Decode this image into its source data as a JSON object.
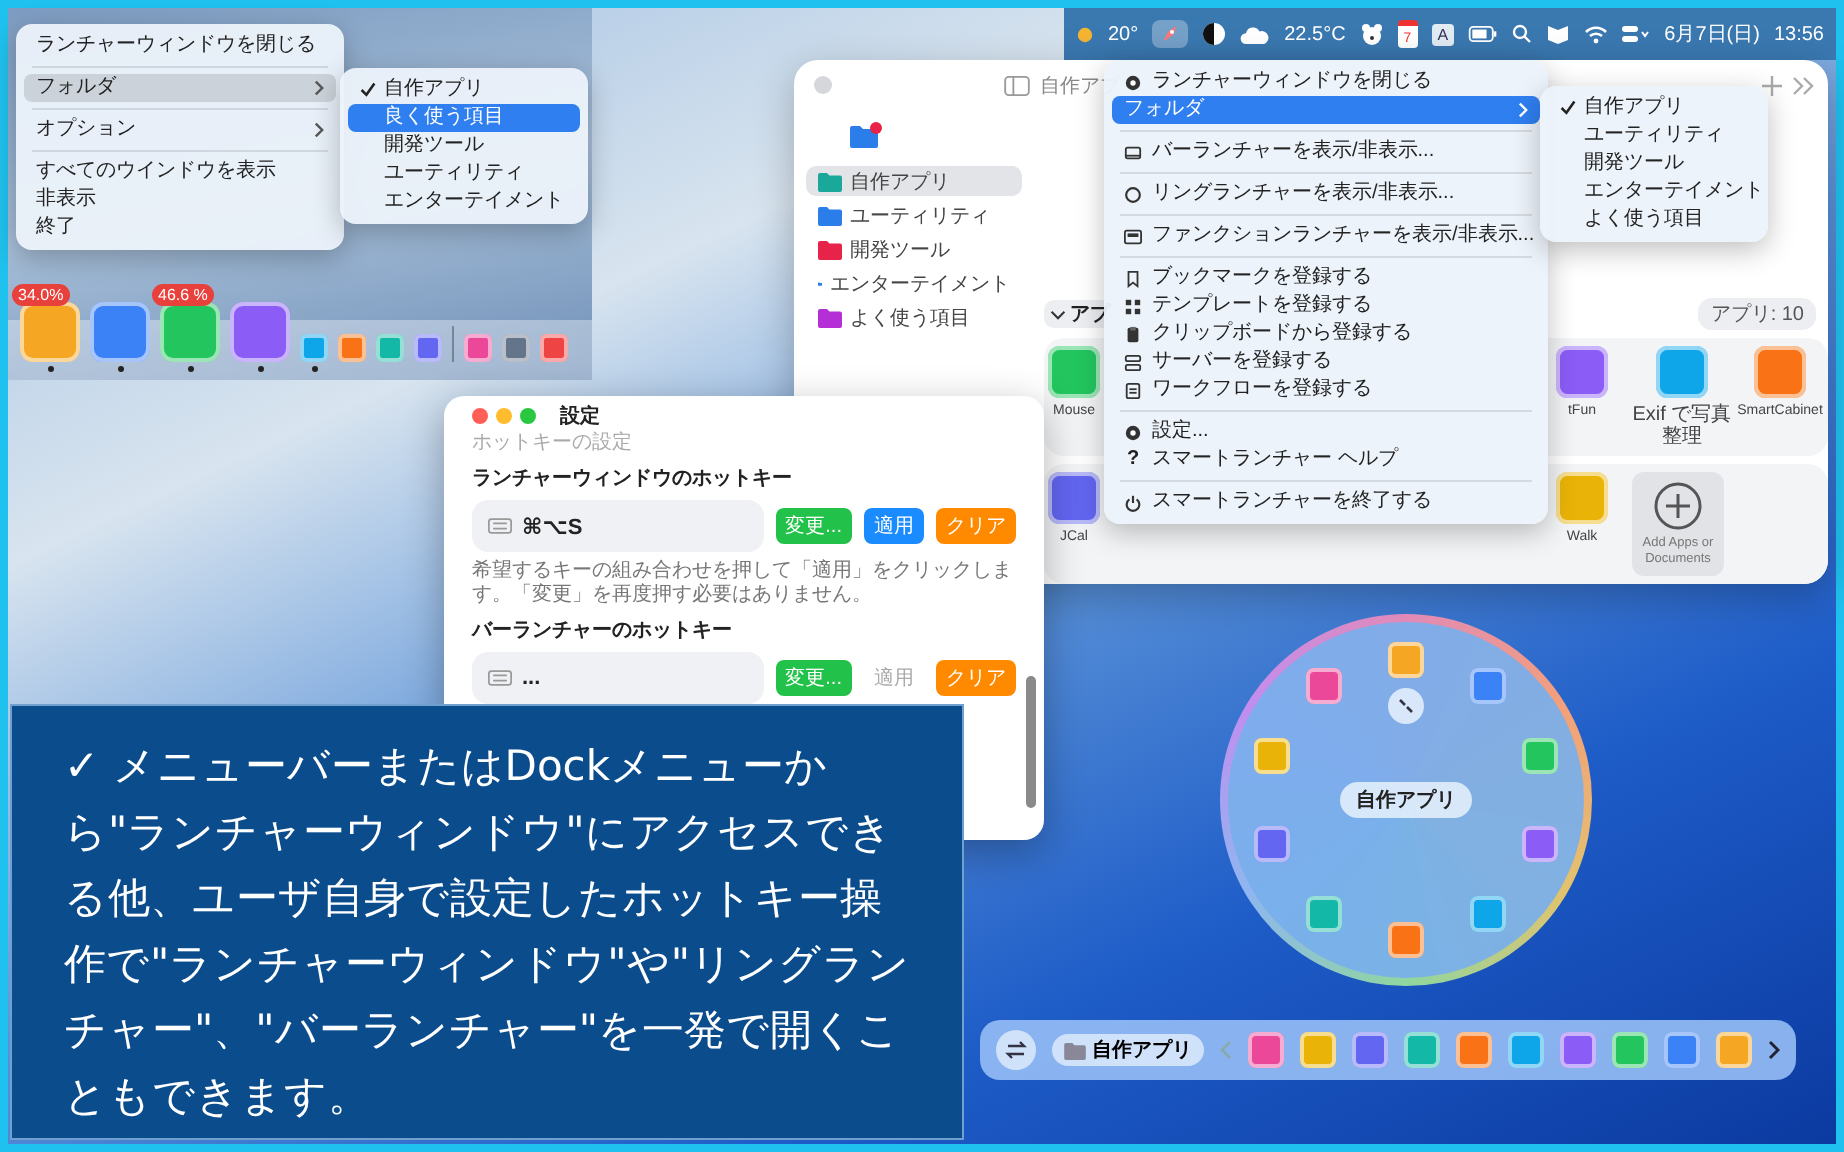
{
  "dock_screenshot": {
    "menu": [
      [
        {
          "label": "ランチャーウィンドウを閉じる",
          "submenu": false,
          "selected": false
        }
      ],
      [
        {
          "label": "フォルダ",
          "submenu": true,
          "selected": true
        }
      ],
      [
        {
          "label": "オプション",
          "submenu": true,
          "selected": false
        }
      ],
      [
        {
          "label": "すべてのウインドウを表示",
          "submenu": false,
          "selected": false
        },
        {
          "label": "非表示",
          "submenu": false,
          "selected": false
        },
        {
          "label": "終了",
          "submenu": false,
          "selected": false
        }
      ]
    ],
    "submenu": [
      {
        "label": "自作アプリ",
        "checked": true,
        "selected": false
      },
      {
        "label": "良く使う項目",
        "checked": false,
        "selected": true
      },
      {
        "label": "開発ツール",
        "checked": false,
        "selected": false
      },
      {
        "label": "ユーティリティ",
        "checked": false,
        "selected": false
      },
      {
        "label": "エンターテイメント",
        "checked": false,
        "selected": false
      }
    ],
    "dock": [
      {
        "kind": "app",
        "badge": "34.0%",
        "running": true
      },
      {
        "kind": "app",
        "running": true
      },
      {
        "kind": "app",
        "badge": "46.6 %",
        "running": true
      },
      {
        "kind": "app",
        "running": true
      },
      {
        "kind": "mini",
        "running": true
      },
      {
        "kind": "mini",
        "running": false
      },
      {
        "kind": "mini",
        "running": false
      },
      {
        "kind": "mini",
        "running": false
      },
      {
        "kind": "divider"
      },
      {
        "kind": "mini",
        "running": false
      },
      {
        "kind": "mini",
        "running": false
      },
      {
        "kind": "mini",
        "running": false
      }
    ]
  },
  "menu_bar": {
    "temperature": "20°",
    "launcher_selected": true,
    "weather": "22.5°C",
    "calendar_day": "7",
    "input_source": "A",
    "date": "6月7日(日)",
    "time": "13:56"
  },
  "launcher_window": {
    "title": "自作アプ",
    "folders": [
      {
        "name": "自作アプリ",
        "color": "#1aa89a",
        "selected": true
      },
      {
        "name": "ユーティリティ",
        "color": "#2b7de9",
        "selected": false
      },
      {
        "name": "開発ツール",
        "color": "#e8234a",
        "selected": false
      },
      {
        "name": "エンターテイメント",
        "color": "#2b7de9",
        "selected": false
      },
      {
        "name": "よく使う項目",
        "color": "#b52fd6",
        "selected": false
      }
    ],
    "section": "アプ",
    "count": "アプリ: 10",
    "rows": [
      [
        {
          "kind": "app",
          "name": "Mouse"
        },
        {
          "kind": "app",
          "name": "tFun"
        },
        {
          "kind": "app",
          "name": "Exif で写真整理"
        },
        {
          "kind": "app",
          "name": "SmartCabinet"
        }
      ],
      [
        {
          "kind": "app",
          "name": "JCal"
        },
        {
          "kind": "app",
          "name": "Walk"
        },
        {
          "kind": "add",
          "name": "Add Apps or Documents"
        }
      ]
    ]
  },
  "context_menu": {
    "sections": [
      [
        {
          "label": "ランチャーウィンドウを閉じる",
          "submenu": false,
          "selected": false
        },
        {
          "label": "フォルダ",
          "submenu": true,
          "selected": true
        }
      ],
      [
        {
          "label": "バーランチャーを表示/非表示...",
          "submenu": false,
          "selected": false
        }
      ],
      [
        {
          "label": "リングランチャーを表示/非表示...",
          "submenu": false,
          "selected": false
        }
      ],
      [
        {
          "label": "ファンクションランチャーを表示/非表示...",
          "submenu": false,
          "selected": false
        }
      ],
      [
        {
          "label": "ブックマークを登録する",
          "submenu": false,
          "selected": false
        },
        {
          "label": "テンプレートを登録する",
          "submenu": false,
          "selected": false
        },
        {
          "label": "クリップボードから登録する",
          "submenu": false,
          "selected": false
        },
        {
          "label": "サーバーを登録する",
          "submenu": false,
          "selected": false
        },
        {
          "label": "ワークフローを登録する",
          "submenu": false,
          "selected": false
        }
      ],
      [
        {
          "label": "設定...",
          "submenu": false,
          "selected": false
        },
        {
          "label": "スマートランチャー ヘルプ",
          "icon_char": "?",
          "submenu": false,
          "selected": false
        }
      ],
      [
        {
          "label": "スマートランチャーを終了する",
          "submenu": false,
          "selected": false
        }
      ]
    ],
    "submenu": [
      {
        "label": "自作アプリ",
        "checked": true,
        "selected": false
      },
      {
        "label": "ユーティリティ",
        "checked": false,
        "selected": false
      },
      {
        "label": "開発ツール",
        "checked": false,
        "selected": false
      },
      {
        "label": "エンターテイメント",
        "checked": false,
        "selected": false
      },
      {
        "label": "よく使う項目",
        "checked": false,
        "selected": false
      }
    ]
  },
  "settings_window": {
    "title": "設定",
    "subtitle": "ホットキーの設定",
    "hotkeys": [
      {
        "label": "ランチャーウィンドウのホットキー",
        "value": "⌘⌥S",
        "buttons": [
          {
            "label": "変更...",
            "kind": "change",
            "disabled": false
          },
          {
            "label": "適用",
            "kind": "apply",
            "disabled": false
          },
          {
            "label": "クリア",
            "kind": "clear",
            "disabled": false
          }
        ],
        "hint": "希望するキーの組み合わせを押して「適用」をクリックします。「変更」を再度押す必要はありません。"
      },
      {
        "label": "バーランチャーのホットキー",
        "value": "...",
        "buttons": [
          {
            "label": "変更...",
            "kind": "change",
            "disabled": false
          },
          {
            "label": "適用",
            "kind": "apply",
            "disabled": true
          },
          {
            "label": "クリア",
            "kind": "clear",
            "disabled": false
          }
        ]
      }
    ]
  },
  "ring_launcher": {
    "label": "自作アプリ"
  },
  "bar_launcher": {
    "folder": "自作アプリ"
  },
  "caption": "✓ メニューバーまたはDockメニューから\"ランチャーウィンドウ\"にアクセスできる他、ユーザ自身で設定したホットキー操作で\"ランチャーウィンドウ\"や\"リングランチャー\"、\"バーランチャー\"を一発で開くこともできます。"
}
